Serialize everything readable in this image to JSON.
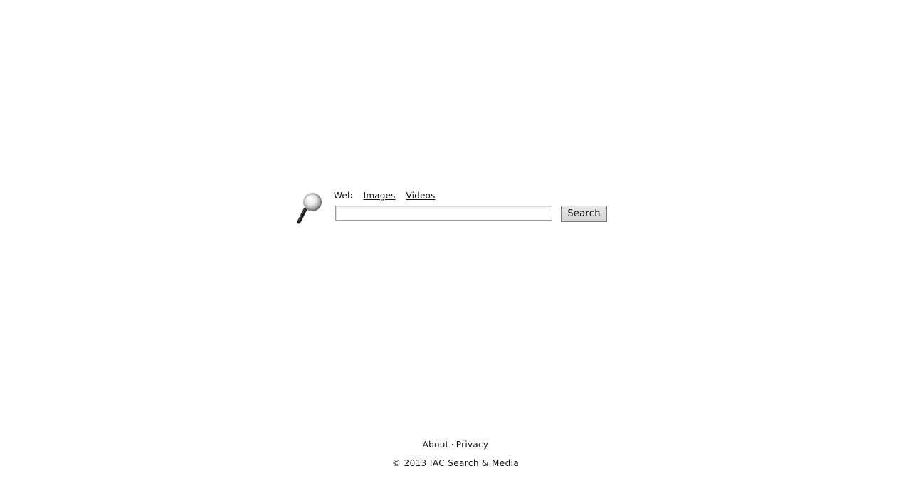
{
  "search": {
    "logo_icon": "magnifying-glass-icon",
    "tabs": [
      {
        "label": "Web",
        "active": true
      },
      {
        "label": "Images",
        "active": false
      },
      {
        "label": "Videos",
        "active": false
      }
    ],
    "input_value": "",
    "input_placeholder": "",
    "button_label": "Search"
  },
  "footer": {
    "about_label": "About",
    "separator": "·",
    "privacy_label": "Privacy",
    "copyright": "© 2013 IAC Search & Media"
  }
}
